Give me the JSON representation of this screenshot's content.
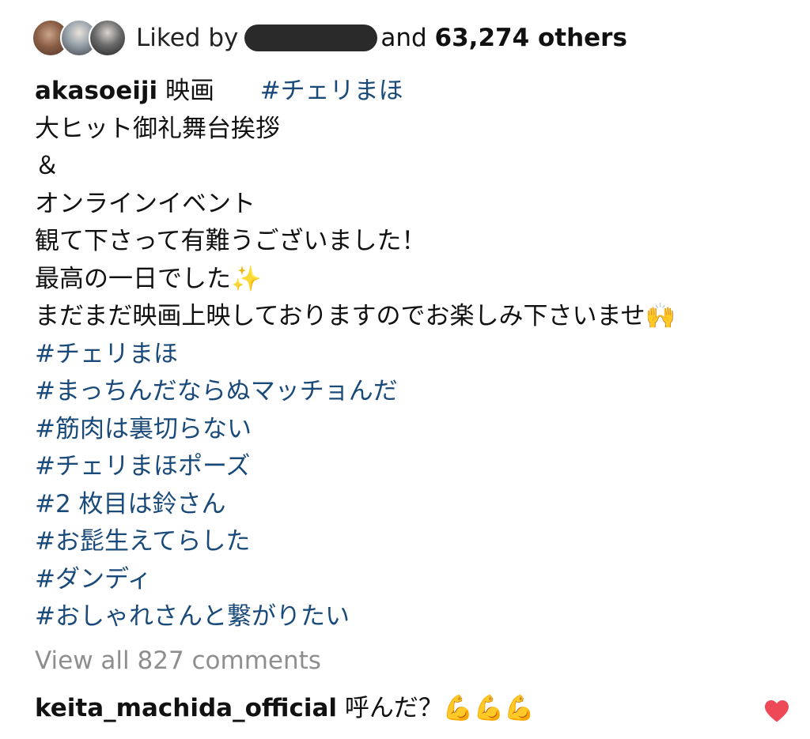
{
  "likes": {
    "prefix": "Liked by",
    "middle": "and",
    "count": "63,274 others",
    "avatars": [
      "avatar-1",
      "avatar-2",
      "avatar-3"
    ],
    "redacted_color": "#2a2a2a"
  },
  "post": {
    "username": "akasoeiji",
    "first_text": "映画",
    "first_hashtag": "#チェリまほ",
    "lines": [
      "大ヒット御礼舞台挨拶",
      "＆",
      "オンラインイベント",
      "観て下さって有難うございました！",
      "最高の一日でした",
      "まだまだ映画上映しておりますのでお楽しみ下さいませ"
    ],
    "emoji_sparkles": "✨",
    "emoji_raised_hands": "🙌",
    "hashtags": [
      "#チェリまほ",
      "#まっちんだならぬマッチョんだ",
      "#筋肉は裏切らない",
      "#チェリまほポーズ",
      "#2 枚目は鈴さん",
      "#お髭生えてらした",
      "#ダンディ",
      "#おしゃれさんと繋がりたい"
    ],
    "hashtag_color": "#1a4a7a"
  },
  "comments": {
    "view_all": "View all 827 comments",
    "first": {
      "username": "keita_machida_official",
      "text": "呼んだ？",
      "emoji": "💪💪💪",
      "like_icon": "heart-icon",
      "like_color": "#ed4956"
    }
  }
}
